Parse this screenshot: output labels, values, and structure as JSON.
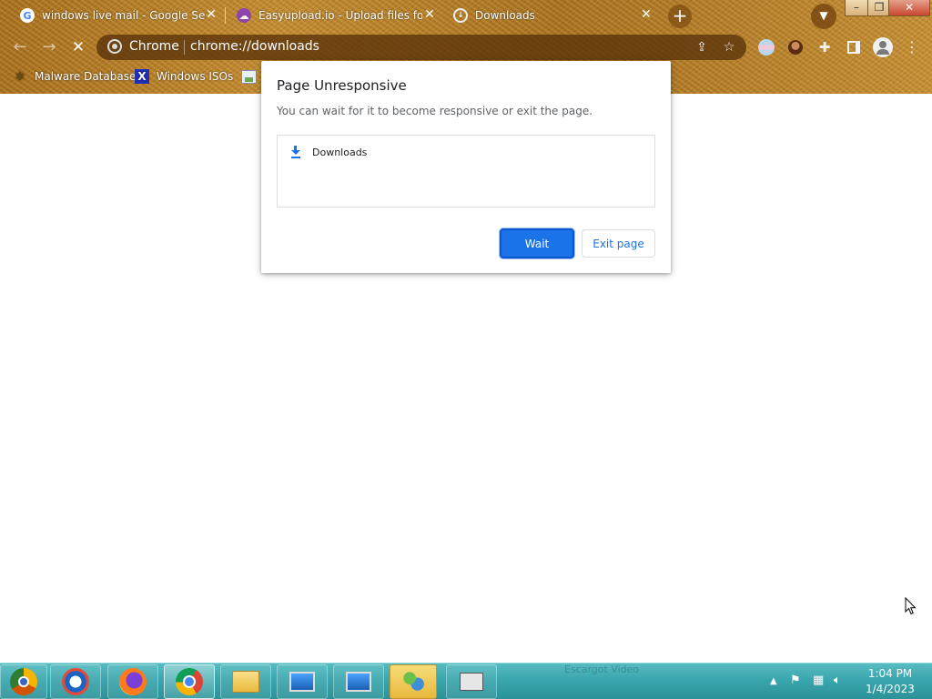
{
  "tabs": [
    {
      "title": "windows live mail - Google Search",
      "icon": "google-icon"
    },
    {
      "title": "Easyupload.io - Upload files for fr",
      "icon": "easyupload-icon"
    },
    {
      "title": "Downloads",
      "icon": "downloads-favicon"
    }
  ],
  "toolbar": {
    "site_label": "Chrome",
    "url": "chrome://downloads"
  },
  "bookmarks": [
    {
      "label": "Malware Database",
      "icon": "bug-icon"
    },
    {
      "label": "Windows ISOs",
      "icon": "x-icon"
    }
  ],
  "dialog": {
    "title": "Page Unresponsive",
    "message": "You can wait for it to become responsive or exit the page.",
    "pages": [
      "Downloads"
    ],
    "wait_label": "Wait",
    "exit_label": "Exit page"
  },
  "taskbar": {
    "background_app_label": "Escargot Video",
    "apps": [
      "chrome-canary",
      "outlook-express",
      "firefox",
      "chrome",
      "file-explorer",
      "remote-desktop-1",
      "remote-desktop-2",
      "messenger",
      "cash-register"
    ]
  },
  "clock": {
    "time": "1:04 PM",
    "date": "1/4/2023"
  },
  "colors": {
    "accent": "#1a73e8",
    "taskbar": "#3aa6ad",
    "theme": "#b07a25"
  }
}
